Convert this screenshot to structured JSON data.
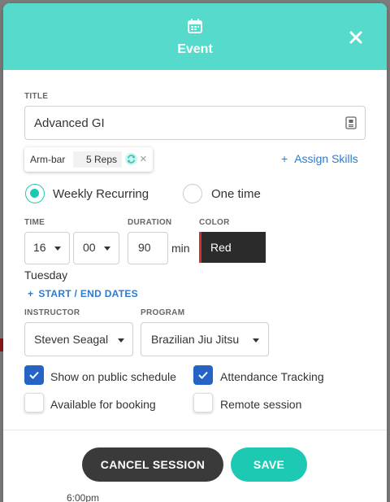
{
  "modal": {
    "title": "Event"
  },
  "form": {
    "title_label": "TITLE",
    "title_value": "Advanced GI",
    "skill_chip": {
      "name": "Arm-bar",
      "reps": "5 Reps"
    },
    "assign_skills": "Assign Skills",
    "recurrence": {
      "weekly": "Weekly Recurring",
      "one_time": "One time",
      "selected": "weekly"
    },
    "time_label": "TIME",
    "time_hour": "16",
    "time_minute": "00",
    "duration_label": "DURATION",
    "duration_value": "90",
    "duration_unit": "min",
    "color_label": "COLOR",
    "color_value": "Red",
    "day": "Tuesday",
    "dates_link": "START / END DATES",
    "instructor_label": "INSTRUCTOR",
    "instructor_value": "Steven Seagal",
    "program_label": "PROGRAM",
    "program_value": "Brazilian Jiu Jitsu",
    "checkboxes": [
      {
        "label": "Show on public schedule",
        "checked": true
      },
      {
        "label": "Attendance Tracking",
        "checked": true
      },
      {
        "label": "Available for booking",
        "checked": false
      },
      {
        "label": "Remote session",
        "checked": false
      }
    ]
  },
  "footer": {
    "cancel_label": "CANCEL SESSION",
    "save_label": "SAVE"
  },
  "background_peek": {
    "time": "6:00pm"
  },
  "colors": {
    "accent": "#55dacb",
    "save": "#1ec9b3",
    "checkbox": "#2563c4",
    "link": "#2b7bd0",
    "cancel": "#3a3a3a",
    "color_swatch": "#d32f2f"
  }
}
